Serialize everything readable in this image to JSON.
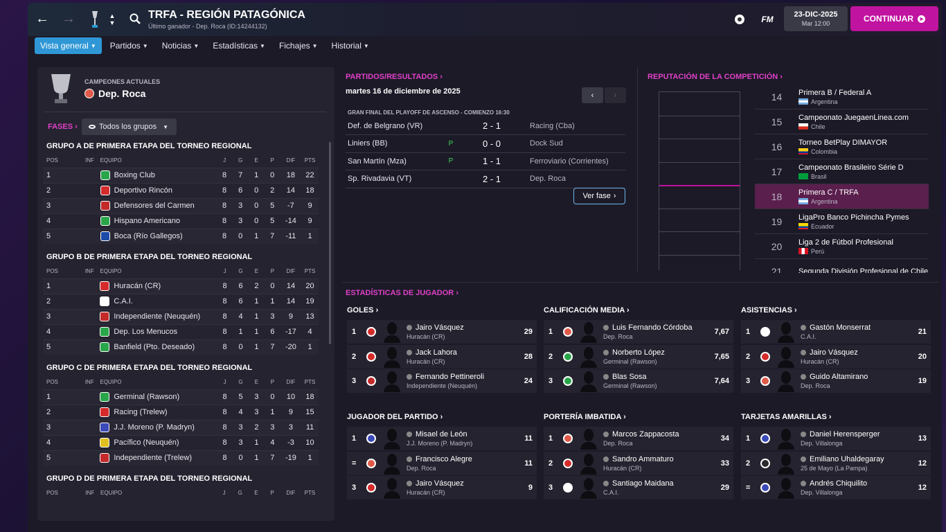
{
  "header": {
    "title": "TRFA - REGIÓN PATAGÓNICA",
    "subtitle": "Último ganador - Dep. Roca (ID:14244132)",
    "fm_label": "FM",
    "date": "23-DIC-2025",
    "time": "Mar 12:00",
    "continue_label": "CONTINUAR"
  },
  "nav": {
    "tabs": [
      "Vista general",
      "Partidos",
      "Noticias",
      "Estadísticas",
      "Fichajes",
      "Historial"
    ]
  },
  "champions": {
    "label": "CAMPEONES ACTUALES",
    "team": "Dep. Roca"
  },
  "phases": {
    "label": "FASES",
    "selector": "Todos los grupos"
  },
  "table_headers": [
    "POS",
    "INF",
    "EQUIPO",
    "J",
    "G",
    "E",
    "P",
    "DIF",
    "PTS"
  ],
  "groups": [
    {
      "name": "GRUPO A DE PRIMERA ETAPA DEL TORNEO REGIONAL",
      "rows": [
        [
          "1",
          "",
          "Boxing Club",
          "8",
          "7",
          "1",
          "0",
          "18",
          "22"
        ],
        [
          "2",
          "",
          "Deportivo Rincón",
          "8",
          "6",
          "0",
          "2",
          "14",
          "18"
        ],
        [
          "3",
          "",
          "Defensores del Carmen",
          "8",
          "3",
          "0",
          "5",
          "-7",
          "9"
        ],
        [
          "4",
          "",
          "Hispano Americano",
          "8",
          "3",
          "0",
          "5",
          "-14",
          "9"
        ],
        [
          "5",
          "",
          "Boca (Río Gallegos)",
          "8",
          "0",
          "1",
          "7",
          "-11",
          "1"
        ]
      ]
    },
    {
      "name": "GRUPO B DE PRIMERA ETAPA DEL TORNEO REGIONAL",
      "rows": [
        [
          "1",
          "",
          "Huracán (CR)",
          "8",
          "6",
          "2",
          "0",
          "14",
          "20"
        ],
        [
          "2",
          "",
          "C.A.I.",
          "8",
          "6",
          "1",
          "1",
          "14",
          "19"
        ],
        [
          "3",
          "",
          "Independiente (Neuquén)",
          "8",
          "4",
          "1",
          "3",
          "9",
          "13"
        ],
        [
          "4",
          "",
          "Dep. Los Menucos",
          "8",
          "1",
          "1",
          "6",
          "-17",
          "4"
        ],
        [
          "5",
          "",
          "Banfield (Pto. Deseado)",
          "8",
          "0",
          "1",
          "7",
          "-20",
          "1"
        ]
      ]
    },
    {
      "name": "GRUPO C DE PRIMERA ETAPA DEL TORNEO REGIONAL",
      "rows": [
        [
          "1",
          "",
          "Germinal (Rawson)",
          "8",
          "5",
          "3",
          "0",
          "10",
          "18"
        ],
        [
          "2",
          "",
          "Racing (Trelew)",
          "8",
          "4",
          "3",
          "1",
          "9",
          "15"
        ],
        [
          "3",
          "",
          "J.J. Moreno (P. Madryn)",
          "8",
          "3",
          "2",
          "3",
          "3",
          "11"
        ],
        [
          "4",
          "",
          "Pacífico (Neuquén)",
          "8",
          "3",
          "1",
          "4",
          "-3",
          "10"
        ],
        [
          "5",
          "",
          "Independiente (Trelew)",
          "8",
          "0",
          "1",
          "7",
          "-19",
          "1"
        ]
      ]
    },
    {
      "name": "GRUPO D DE PRIMERA ETAPA DEL TORNEO REGIONAL",
      "rows": []
    }
  ],
  "crest_colors": [
    [
      "#2aa64a",
      "#d52b2b",
      "#c42a2a",
      "#2aa64a",
      "#1c4aa8"
    ],
    [
      "#d52b2b",
      "#ffffff",
      "#c42a2a",
      "#2aa64a",
      "#2aa64a"
    ],
    [
      "#2aa64a",
      "#d52b2b",
      "#3a4ab8",
      "#e0c020",
      "#c42a2a"
    ]
  ],
  "results": {
    "title": "PARTIDOS/RESULTADOS",
    "date": "martes 16 de diciembre de 2025",
    "stage": "GRAN FINAL DEL PLAYOFF DE ASCENSO - COMIENZO 16:30",
    "matches": [
      {
        "home": "Def. de Belgrano (VR)",
        "p": "",
        "score": "2 - 1",
        "away": "Racing (Cba)"
      },
      {
        "home": "Liniers (BB)",
        "p": "P",
        "score": "0 - 0",
        "away": "Dock Sud"
      },
      {
        "home": "San Martín (Mza)",
        "p": "P",
        "score": "1 - 1",
        "away": "Ferroviario (Corrientes)"
      },
      {
        "home": "Sp. Rivadavia (VT)",
        "p": "",
        "score": "2 - 1",
        "away": "Dep. Roca"
      }
    ],
    "ver_fase": "Ver fase"
  },
  "reputation": {
    "title": "REPUTACIÓN DE LA COMPETICIÓN",
    "highlight_rank": 18,
    "items": [
      {
        "rank": "14",
        "name": "Primera B / Federal A",
        "country": "Argentina",
        "flag": "ar"
      },
      {
        "rank": "15",
        "name": "Campeonato JuegaenLinea.com",
        "country": "Chile",
        "flag": "cl"
      },
      {
        "rank": "16",
        "name": "Torneo BetPlay DIMAYOR",
        "country": "Colombia",
        "flag": "co"
      },
      {
        "rank": "17",
        "name": "Campeonato Brasileiro Série D",
        "country": "Brasil",
        "flag": "br"
      },
      {
        "rank": "18",
        "name": "Primera C / TRFA",
        "country": "Argentina",
        "flag": "ar"
      },
      {
        "rank": "19",
        "name": "LigaPro Banco Pichincha Pymes",
        "country": "Ecuador",
        "flag": "ec"
      },
      {
        "rank": "20",
        "name": "Liga 2 de Fútbol Profesional",
        "country": "Perú",
        "flag": "pe"
      },
      {
        "rank": "21",
        "name": "Segunda División Profesional de Chile",
        "country": "",
        "flag": ""
      }
    ]
  },
  "player_stats": {
    "title": "ESTADÍSTICAS DE JUGADOR",
    "blocks": [
      {
        "title": "GOLES",
        "rows": [
          {
            "rank": "1",
            "name": "Jairo Vásquez",
            "club": "Huracán (CR)",
            "value": "29",
            "crest": "#d52b2b"
          },
          {
            "rank": "2",
            "name": "Jack Lahora",
            "club": "Huracán (CR)",
            "value": "28",
            "crest": "#d52b2b"
          },
          {
            "rank": "3",
            "name": "Fernando Pettineroli",
            "club": "Independiente (Neuquén)",
            "value": "24",
            "crest": "#c42a2a"
          }
        ]
      },
      {
        "title": "CALIFICACIÓN MEDIA",
        "rows": [
          {
            "rank": "1",
            "name": "Luis Fernando Córdoba",
            "club": "Dep. Roca",
            "value": "7,67",
            "crest": "#e05a4a"
          },
          {
            "rank": "2",
            "name": "Norberto López",
            "club": "Germinal (Rawson)",
            "value": "7,65",
            "crest": "#2aa64a"
          },
          {
            "rank": "3",
            "name": "Blas Sosa",
            "club": "Germinal (Rawson)",
            "value": "7,64",
            "crest": "#2aa64a"
          }
        ]
      },
      {
        "title": "ASISTENCIAS",
        "rows": [
          {
            "rank": "1",
            "name": "Gastón Monserrat",
            "club": "C.A.I.",
            "value": "21",
            "crest": "#ffffff"
          },
          {
            "rank": "2",
            "name": "Jairo Vásquez",
            "club": "Huracán (CR)",
            "value": "20",
            "crest": "#d52b2b"
          },
          {
            "rank": "3",
            "name": "Guido Altamirano",
            "club": "Dep. Roca",
            "value": "19",
            "crest": "#e05a4a"
          }
        ]
      },
      {
        "title": "JUGADOR DEL PARTIDO",
        "rows": [
          {
            "rank": "1",
            "name": "Misael de León",
            "club": "J.J. Moreno (P. Madryn)",
            "value": "11",
            "crest": "#3a4ab8"
          },
          {
            "rank": "=",
            "name": "Francisco Alegre",
            "club": "Dep. Roca",
            "value": "11",
            "crest": "#e05a4a"
          },
          {
            "rank": "3",
            "name": "Jairo Vásquez",
            "club": "Huracán (CR)",
            "value": "9",
            "crest": "#d52b2b"
          }
        ]
      },
      {
        "title": "PORTERÍA IMBATIDA",
        "rows": [
          {
            "rank": "1",
            "name": "Marcos Zappacosta",
            "club": "Dep. Roca",
            "value": "34",
            "crest": "#e05a4a"
          },
          {
            "rank": "2",
            "name": "Sandro Ammaturo",
            "club": "Huracán (CR)",
            "value": "33",
            "crest": "#d52b2b"
          },
          {
            "rank": "3",
            "name": "Santiago Maidana",
            "club": "C.A.I.",
            "value": "29",
            "crest": "#ffffff"
          }
        ]
      },
      {
        "title": "TARJETAS AMARILLAS",
        "rows": [
          {
            "rank": "1",
            "name": "Daniel Herensperger",
            "club": "Dep. Villalonga",
            "value": "13",
            "crest": "#3a4ab8"
          },
          {
            "rank": "2",
            "name": "Emiliano Uhaldegaray",
            "club": "25 de Mayo (La Pampa)",
            "value": "12",
            "crest": "#2a2a2a"
          },
          {
            "rank": "=",
            "name": "Andrés Chiquilito",
            "club": "Dep. Villalonga",
            "value": "12",
            "crest": "#3a4ab8"
          }
        ]
      }
    ]
  }
}
